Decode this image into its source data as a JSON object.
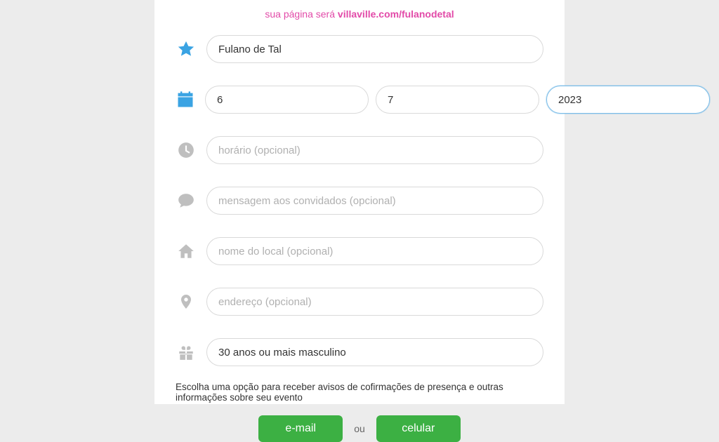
{
  "url_hint": {
    "prefix": "sua página será ",
    "domain_slug": "villaville.com/fulanodetal"
  },
  "fields": {
    "name_value": "Fulano de Tal",
    "date_day": "6",
    "date_month": "7",
    "date_year": "2023",
    "time_placeholder": "horário (opcional)",
    "message_placeholder": "mensagem aos convidados (opcional)",
    "venue_placeholder": "nome do local (opcional)",
    "address_placeholder": "endereço (opcional)",
    "gift_value": "30 anos ou mais masculino"
  },
  "notify": {
    "instruction": "Escolha uma opção para receber avisos de cofirmações de presença e outras informações sobre seu evento",
    "email_label": "e-mail",
    "or_label": "ou",
    "phone_label": "celular"
  }
}
